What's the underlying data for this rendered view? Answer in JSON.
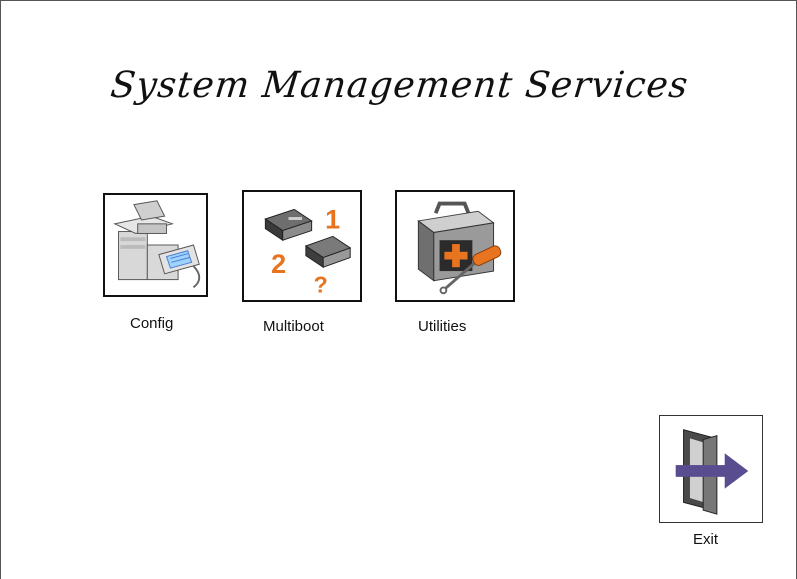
{
  "title": "System Management Services",
  "menu": {
    "config_label": "Config",
    "multiboot_label": "Multiboot",
    "utilities_label": "Utilities",
    "exit_label": "Exit"
  },
  "multiboot_icon_text": {
    "one": "1",
    "two": "2",
    "question": "?"
  },
  "colors": {
    "accent_orange": "#e8741f",
    "exit_arrow": "#5a4d8f",
    "icon_gray": "#8a8a8a"
  },
  "icons": {
    "config": "printer-fax-computer-icon",
    "multiboot": "boot-devices-icon",
    "utilities": "toolbox-medical-icon",
    "exit": "exit-door-arrow-icon"
  }
}
